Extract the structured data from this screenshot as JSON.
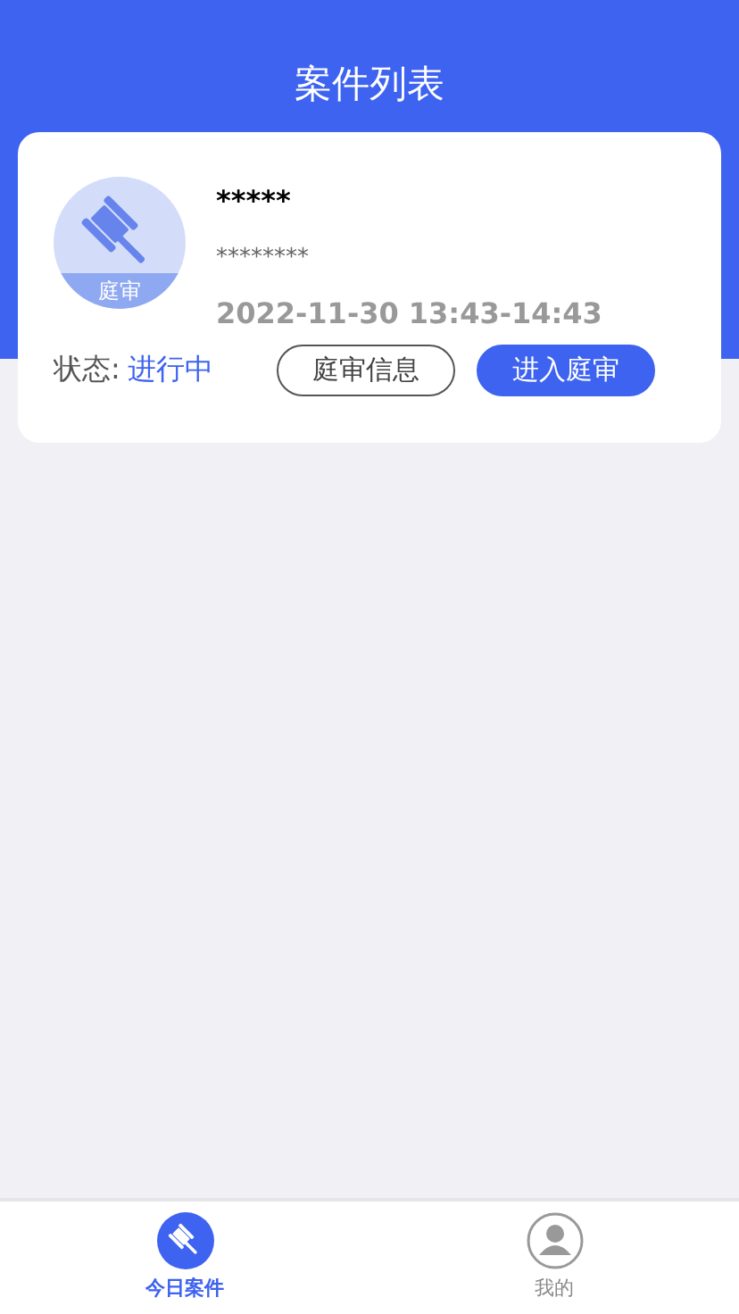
{
  "header": {
    "title": "案件列表"
  },
  "cases": [
    {
      "badge": "庭审",
      "title": "*****",
      "subtitle": "********",
      "time": "2022-11-30 13:43-14:43",
      "status_label": "状态:",
      "status": "进行中",
      "buttons": [
        {
          "label": "庭审信息",
          "kind": "outline"
        },
        {
          "label": "进入庭审",
          "kind": "primary"
        }
      ]
    }
  ],
  "tab_bar": [
    {
      "label": "今日案件",
      "kind": "gavel",
      "selected": true
    },
    {
      "label": "我的",
      "kind": "person",
      "selected": false
    }
  ]
}
